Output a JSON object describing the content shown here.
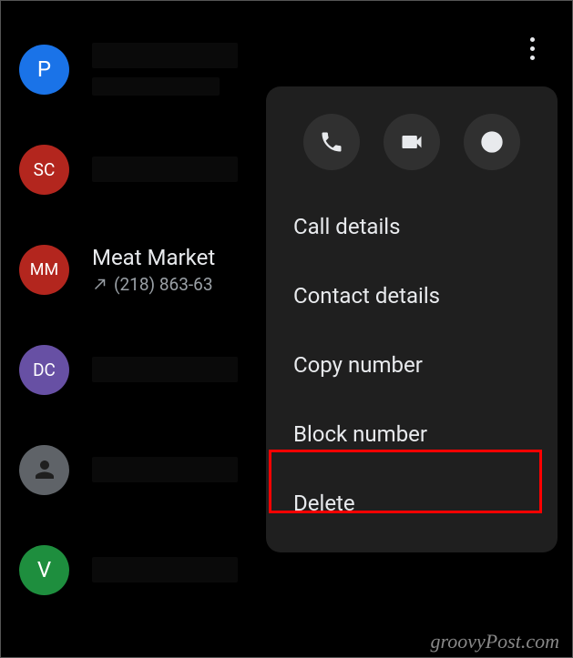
{
  "call_list": [
    {
      "initials": "P",
      "avatar_class": "avatar-p",
      "name": "",
      "detail": ""
    },
    {
      "initials": "SC",
      "avatar_class": "avatar-sc",
      "name": "",
      "detail": ""
    },
    {
      "initials": "MM",
      "avatar_class": "avatar-mm",
      "name": "Meat Market",
      "detail": "(218) 863-63"
    },
    {
      "initials": "DC",
      "avatar_class": "avatar-dc",
      "name": "",
      "detail": ""
    },
    {
      "initials": "",
      "avatar_class": "avatar-default",
      "name": "",
      "detail": ""
    },
    {
      "initials": "V",
      "avatar_class": "avatar-v",
      "name": "",
      "detail": ""
    }
  ],
  "context_menu": {
    "items": [
      {
        "label": "Call details"
      },
      {
        "label": "Contact details"
      },
      {
        "label": "Copy number"
      },
      {
        "label": "Block number"
      },
      {
        "label": "Delete"
      }
    ]
  },
  "watermark": "groovyPost.com"
}
